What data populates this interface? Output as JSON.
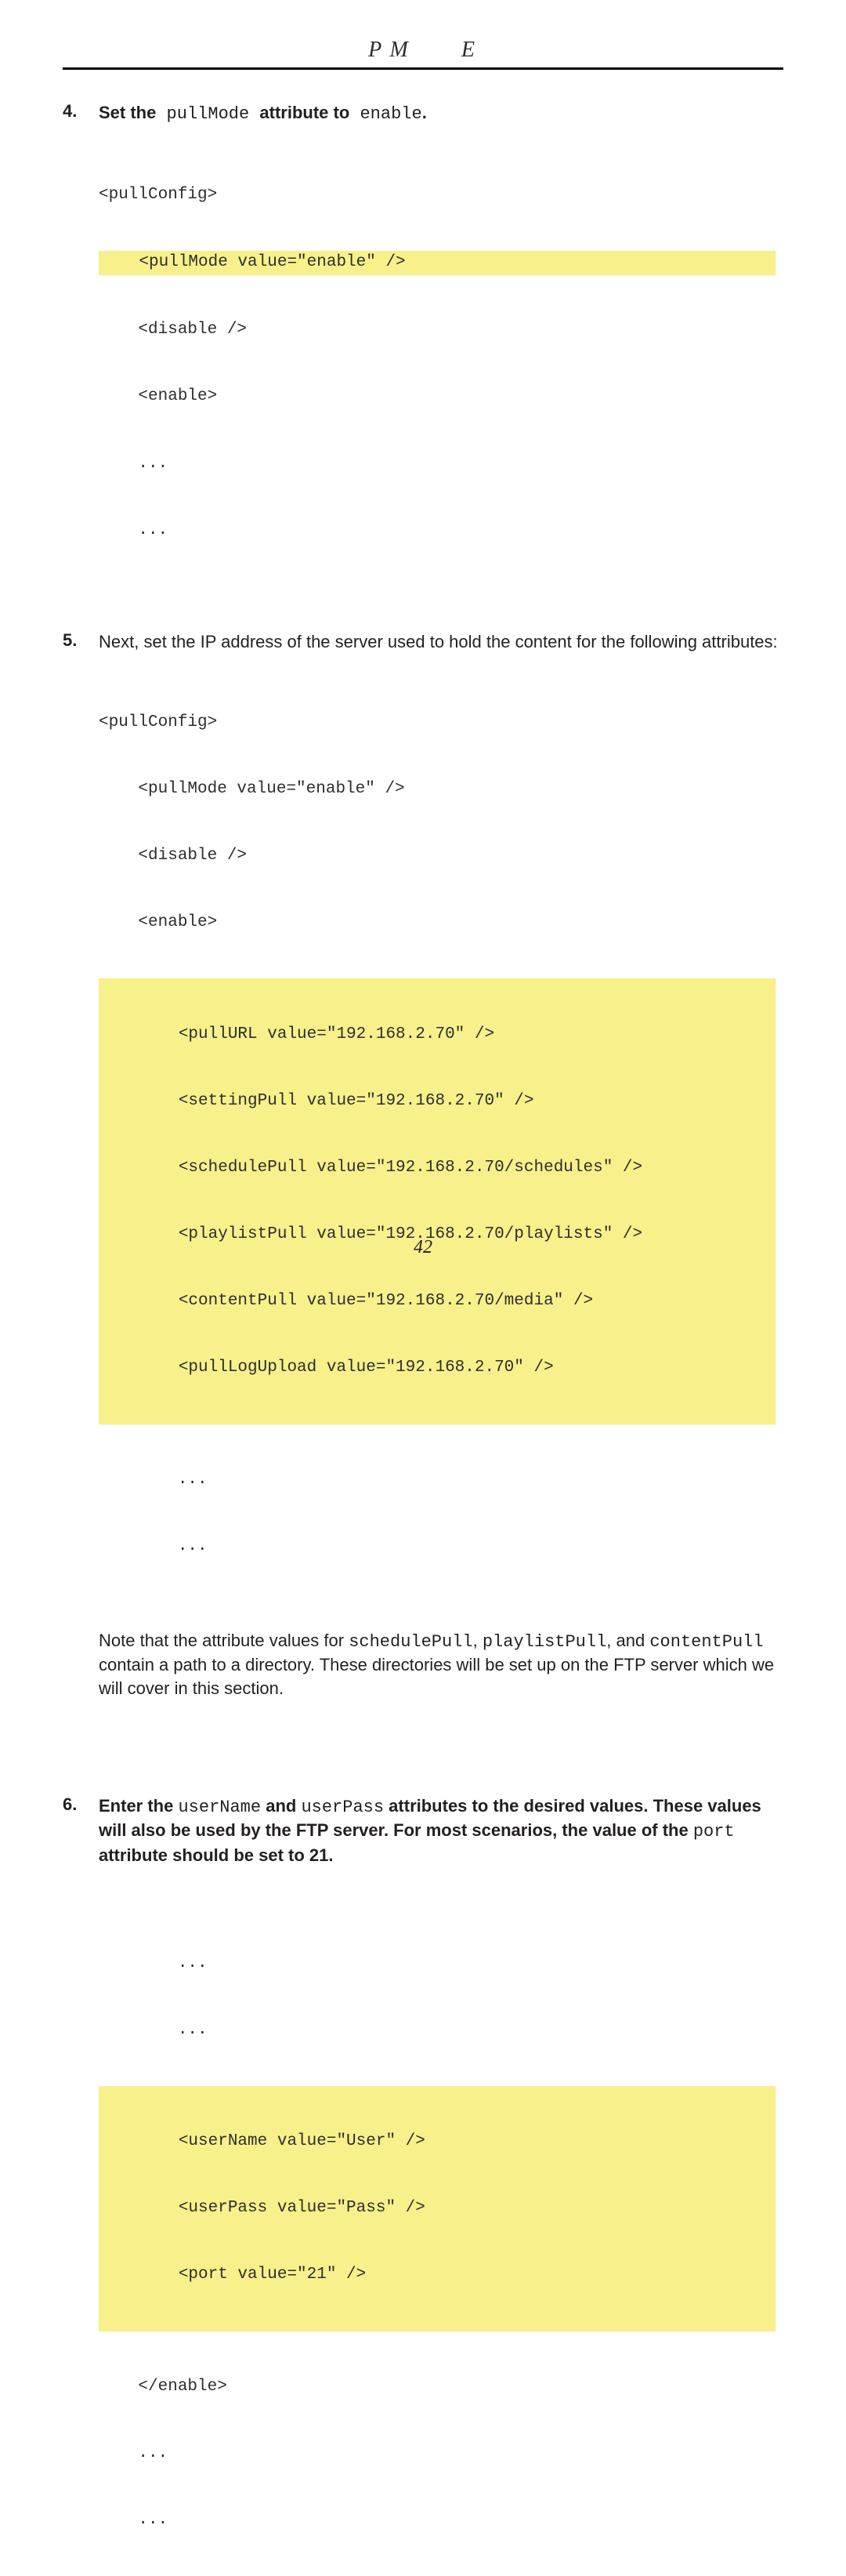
{
  "header": {
    "running_head": "P M  E"
  },
  "steps": {
    "s4": {
      "num": "4.",
      "text_before": "Set the",
      "code_inline_1": " pullMode ",
      "text_mid": "attribute to",
      "code_inline_2": " enable",
      "text_after": "."
    },
    "s5": {
      "num": "5.",
      "text": "Next, set the IP address of the server used to hold the content for the following attributes:"
    },
    "s6": {
      "num": "6.",
      "part1": "Enter the ",
      "code1": "userName",
      "part2": " and ",
      "code2": "userPass",
      "part3": " attributes to the desired values.  These values will also be used by the FTP server.  For most scenarios, the value of the ",
      "code3": "port",
      "part4": " attribute should be set to 21."
    }
  },
  "code4": {
    "l1": "<pullConfig>",
    "hl": "    <pullMode value=\"enable\" />",
    "l3": "    <disable />",
    "l4": "    <enable>",
    "l5": "    ...",
    "l6": "    ..."
  },
  "code5": {
    "l1": "<pullConfig>",
    "l2": "    <pullMode value=\"enable\" />",
    "l3": "    <disable />",
    "l4": "    <enable>",
    "hl1": "        <pullURL value=\"192.168.2.70\" />",
    "hl2": "        <settingPull value=\"192.168.2.70\" />",
    "hl3": "        <schedulePull value=\"192.168.2.70/schedules\" />",
    "hl4": "        <playlistPull value=\"192.168.2.70/playlists\" />",
    "hl5": "        <contentPull value=\"192.168.2.70/media\" />",
    "hl6": "        <pullLogUpload value=\"192.168.2.70\" />",
    "l11": "        ...",
    "l12": "        ..."
  },
  "note5": {
    "p1": "Note that the attribute values for ",
    "c1": "schedulePull",
    "p2": ", ",
    "c2": "playlistPull",
    "p3": ", and ",
    "c3": "contentPull",
    "p4": " contain a path to a directory. These directories will be set up on the FTP server which we will cover in this section."
  },
  "code6": {
    "l1": "        ...",
    "l2": "        ...",
    "hl1": "        <userName value=\"User\" />",
    "hl2": "        <userPass value=\"Pass\" />",
    "hl3": "        <port value=\"21\" />",
    "l6": "    </enable>",
    "l7": "    ...",
    "l8": "    ..."
  },
  "page_number": "42"
}
